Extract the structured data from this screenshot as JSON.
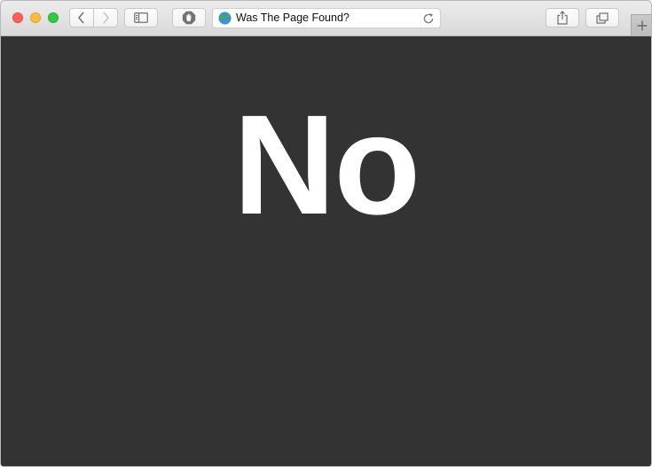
{
  "window": {
    "controls": [
      "close",
      "minimize",
      "maximize"
    ]
  },
  "toolbar": {
    "back_icon": "chevron-left-icon",
    "forward_icon": "chevron-right-icon",
    "sidebar_icon": "sidebar-icon",
    "extension_icon": "hand-stop-icon",
    "share_icon": "share-icon",
    "tabs_icon": "tabs-overview-icon",
    "new_tab_icon": "plus-icon"
  },
  "address_bar": {
    "favicon": "globe-icon",
    "title": "Was The Page Found?",
    "reload_icon": "reload-icon"
  },
  "page": {
    "background": "#333333",
    "text_color": "#ffffff",
    "headline": "No"
  }
}
